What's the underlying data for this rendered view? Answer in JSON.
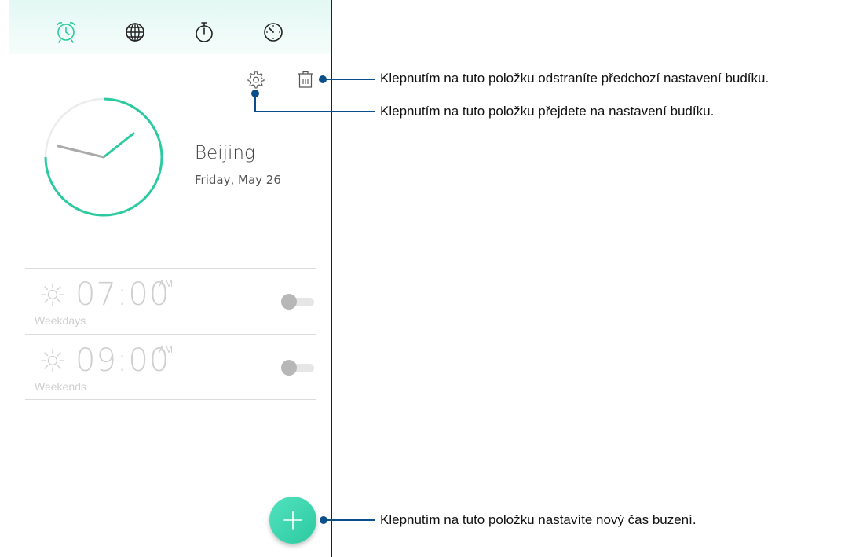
{
  "tabs": [
    {
      "name": "alarm",
      "icon": "alarm-clock-icon",
      "active": true
    },
    {
      "name": "world-clock",
      "icon": "globe-icon",
      "active": false
    },
    {
      "name": "stopwatch",
      "icon": "stopwatch-icon",
      "active": false
    },
    {
      "name": "timer",
      "icon": "timer-icon",
      "active": false
    }
  ],
  "world_clock": {
    "city": "Beijing",
    "date": "Friday, May 26"
  },
  "alarms": [
    {
      "time": "07:00",
      "ampm": "AM",
      "repeat": "Weekdays",
      "enabled": false
    },
    {
      "time": "09:00",
      "ampm": "AM",
      "repeat": "Weekends",
      "enabled": false
    }
  ],
  "actions": {
    "settings_icon": "gear-icon",
    "delete_icon": "trash-icon",
    "add_icon": "plus-icon"
  },
  "callouts": {
    "delete": "Klepnutím na tuto položku odstraníte předchozí nastavení budíku.",
    "settings": "Klepnutím na tuto položku přejdete na nastavení budíku.",
    "add": "Klepnutím na tuto položku nastavíte nový čas buzení."
  },
  "colors": {
    "accent": "#2ccaa0",
    "callout_line": "#0b4f8a",
    "inactive": "#cfcfcf"
  }
}
